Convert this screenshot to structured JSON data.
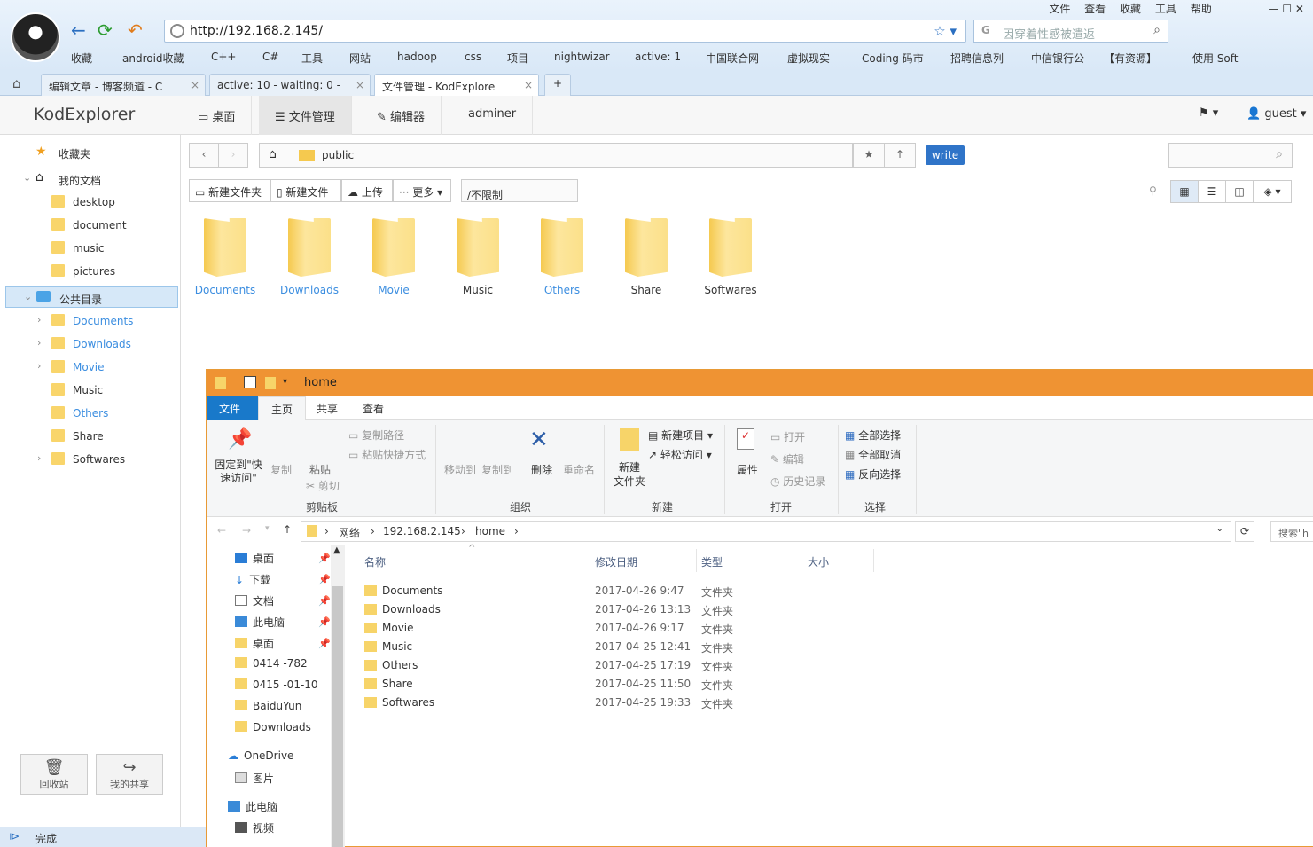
{
  "browser": {
    "url": "http://192.168.2.145/",
    "search_placeholder": "因穿着性感被遣返",
    "menu": [
      "文件",
      "查看",
      "收藏",
      "工具",
      "帮助"
    ],
    "bookmarks": [
      "收藏",
      "android收藏",
      "C++",
      "C#",
      "工具",
      "网站",
      "hadoop",
      "css",
      "项目",
      "nightwizar",
      "active: 1",
      "中国联合网",
      "虚拟现实 -",
      "Coding 码市",
      "招聘信息列",
      "中信银行公",
      "【有资源】",
      "使用 Soft"
    ],
    "tabs": [
      {
        "label": "编辑文章 - 博客频道 - C"
      },
      {
        "label": "active: 10 - waiting: 0 -"
      },
      {
        "label": "文件管理 - KodExplore"
      }
    ],
    "status": "完成"
  },
  "kod": {
    "logo": "KodExplorer",
    "nav": [
      "桌面",
      "文件管理",
      "编辑器",
      "adminer"
    ],
    "user": "guest",
    "path": "public",
    "write_badge": "write",
    "actions": [
      "新建文件夹",
      "新建文件",
      "上传",
      "更多"
    ],
    "quota": "/不限制",
    "sidebar": {
      "favorites": "收藏夹",
      "my_docs": "我的文档",
      "my_docs_items": [
        "desktop",
        "document",
        "music",
        "pictures"
      ],
      "public": "公共目录",
      "public_items": [
        "Documents",
        "Downloads",
        "Movie",
        "Music",
        "Others",
        "Share",
        "Softwares"
      ],
      "recycle": "回收站",
      "my_share": "我的共享"
    },
    "folders": [
      "Documents",
      "Downloads",
      "Movie",
      "Music",
      "Others",
      "Share",
      "Softwares"
    ]
  },
  "explorer": {
    "title": "home",
    "tabs": [
      "文件",
      "主页",
      "共享",
      "查看"
    ],
    "ribbon": {
      "pin": "固定到\"快速访问\"",
      "copy": "复制",
      "paste": "粘贴",
      "copy_path": "复制路径",
      "paste_shortcut": "粘贴快捷方式",
      "cut": "剪切",
      "clipboard": "剪贴板",
      "move_to": "移动到",
      "copy_to": "复制到",
      "delete": "删除",
      "rename": "重命名",
      "organize": "组织",
      "new_item": "新建项目",
      "easy_access": "轻松访问",
      "new_folder": "新建\n文件夹",
      "new_group": "新建",
      "properties": "属性",
      "open": "打开",
      "edit": "编辑",
      "history": "历史记录",
      "open_group": "打开",
      "select_all": "全部选择",
      "select_none": "全部取消",
      "invert": "反向选择",
      "select_group": "选择"
    },
    "address": [
      "网络",
      "192.168.2.145",
      "home"
    ],
    "search_placeholder": "搜索\"h",
    "nav": [
      {
        "label": "桌面",
        "pin": true
      },
      {
        "label": "下载",
        "pin": true
      },
      {
        "label": "文档",
        "pin": true
      },
      {
        "label": "此电脑",
        "pin": true
      },
      {
        "label": "桌面",
        "pin": true
      },
      {
        "label": "0414 -782"
      },
      {
        "label": "0415 -01-10"
      },
      {
        "label": "BaiduYun"
      },
      {
        "label": "Downloads"
      }
    ],
    "onedrive": "OneDrive",
    "onedrive_pictures": "图片",
    "this_pc": "此电脑",
    "this_pc_videos": "视频",
    "columns": [
      "名称",
      "修改日期",
      "类型",
      "大小"
    ],
    "files": [
      {
        "name": "Documents",
        "date": "2017-04-26 9:47",
        "type": "文件夹"
      },
      {
        "name": "Downloads",
        "date": "2017-04-26 13:13",
        "type": "文件夹"
      },
      {
        "name": "Movie",
        "date": "2017-04-26 9:17",
        "type": "文件夹"
      },
      {
        "name": "Music",
        "date": "2017-04-25 12:41",
        "type": "文件夹"
      },
      {
        "name": "Others",
        "date": "2017-04-25 17:19",
        "type": "文件夹"
      },
      {
        "name": "Share",
        "date": "2017-04-25 11:50",
        "type": "文件夹"
      },
      {
        "name": "Softwares",
        "date": "2017-04-25 19:33",
        "type": "文件夹"
      }
    ]
  }
}
